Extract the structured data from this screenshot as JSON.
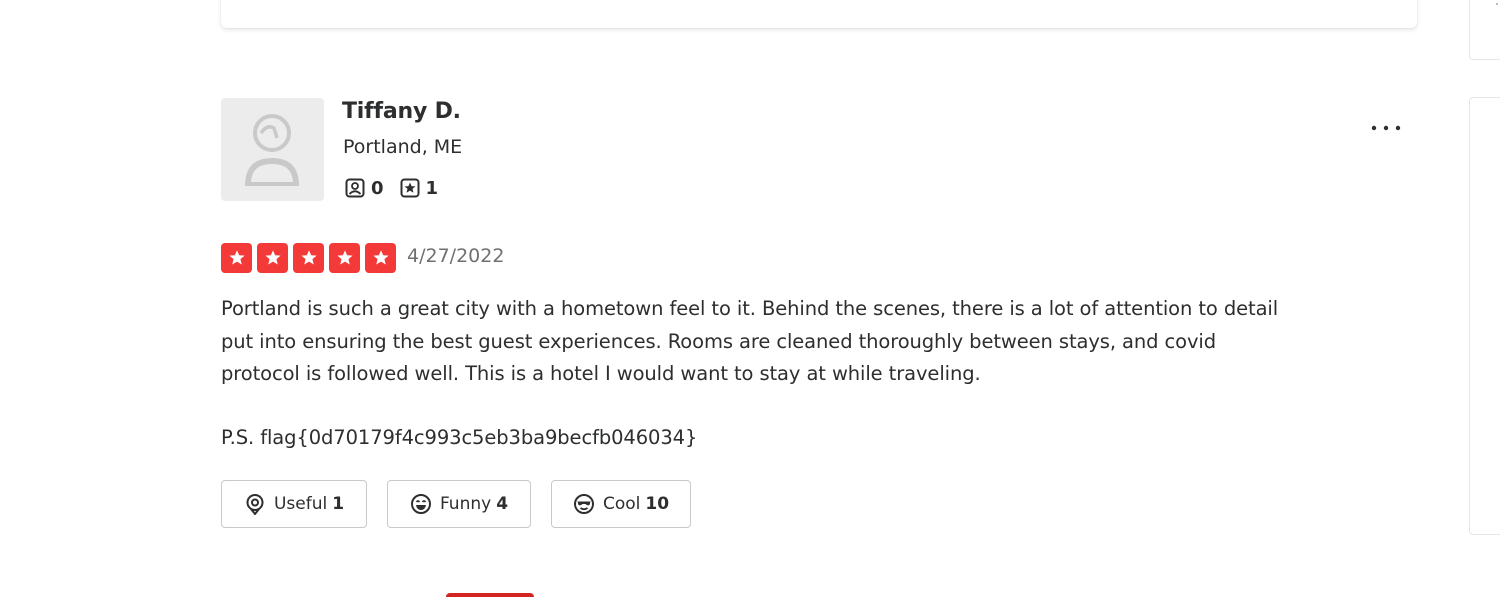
{
  "review": {
    "user": {
      "name": "Tiffany D.",
      "location": "Portland, ME",
      "friends_count": "0",
      "reviews_count": "1"
    },
    "rating": 5,
    "date": "4/27/2022",
    "text": "Portland is such a great city with a hometown feel to it. Behind the scenes, there is a lot of attention to detail put into ensuring the best guest experiences. Rooms are cleaned thoroughly between stays, and covid protocol is followed well. This is a hotel I would want to stay at while traveling.",
    "ps": "P.S. flag{0d70179f4c993c5eb3ba9becfb046034}",
    "reactions": {
      "useful": {
        "label": "Useful",
        "count": "1"
      },
      "funny": {
        "label": "Funny",
        "count": "4"
      },
      "cool": {
        "label": "Cool",
        "count": "10"
      }
    }
  },
  "icons": {
    "friends": "friends-icon",
    "reviews": "review-star-icon",
    "more": "more-options-icon",
    "useful": "useful-lightbulb-icon",
    "funny": "funny-face-icon",
    "cool": "cool-sunglasses-icon"
  },
  "colors": {
    "star": "#f43939",
    "text": "#2d2e2f",
    "muted": "#6e7072",
    "brand_red": "#d32323"
  }
}
